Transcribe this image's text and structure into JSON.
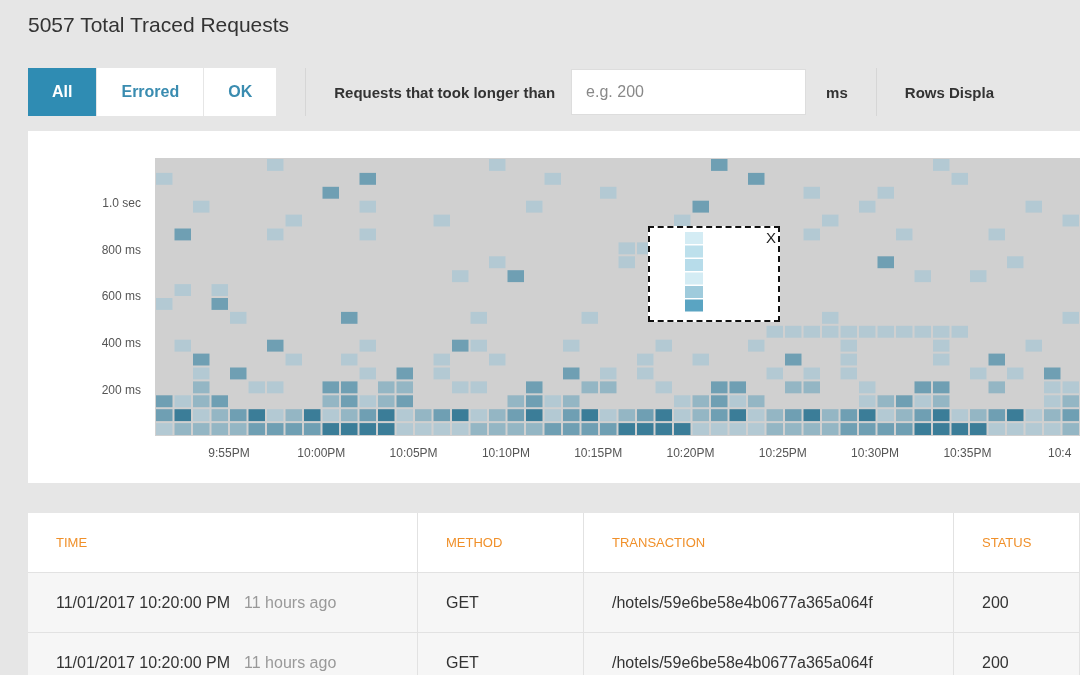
{
  "title": "5057 Total Traced Requests",
  "tabs": [
    {
      "label": "All",
      "selected": true
    },
    {
      "label": "Errored",
      "selected": false
    },
    {
      "label": "OK",
      "selected": false
    }
  ],
  "filter": {
    "label": "Requests that took longer than",
    "placeholder": "e.g. 200",
    "unit": "ms",
    "rows_label": "Rows Displa"
  },
  "heatmap": {
    "y_labels": [
      "1.0 sec",
      "800 ms",
      "600 ms",
      "400 ms",
      "200 ms"
    ],
    "x_labels": [
      "9:55PM",
      "10:00PM",
      "10:05PM",
      "10:10PM",
      "10:15PM",
      "10:20PM",
      "10:25PM",
      "10:30PM",
      "10:35PM",
      "10:4"
    ],
    "selection_close": "X"
  },
  "table": {
    "columns": [
      "TIME",
      "METHOD",
      "TRANSACTION",
      "STATUS"
    ],
    "rows": [
      {
        "time": "11/01/2017 10:20:00 PM",
        "ago": "11 hours ago",
        "method": "GET",
        "transaction": "/hotels/59e6be58e4b0677a365a064f",
        "status": "200"
      },
      {
        "time": "11/01/2017 10:20:00 PM",
        "ago": "11 hours ago",
        "method": "GET",
        "transaction": "/hotels/59e6be58e4b0677a365a064f",
        "status": "200"
      }
    ]
  }
}
